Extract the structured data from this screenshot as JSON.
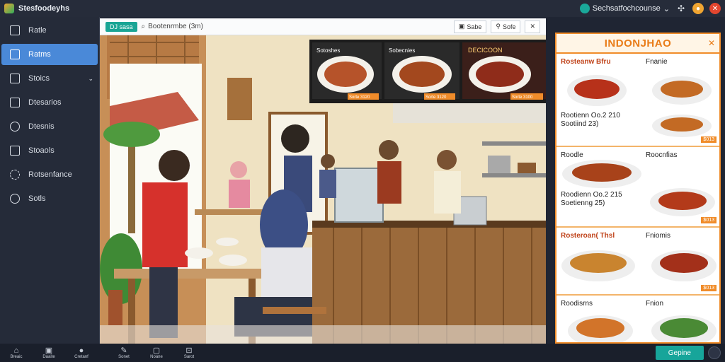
{
  "window": {
    "title": "Stesfoodeyhs"
  },
  "account": {
    "label": "Sechsatfochcounse"
  },
  "sidebar": {
    "items": [
      {
        "label": "Ratle"
      },
      {
        "label": "Ratms"
      },
      {
        "label": "Stoics"
      },
      {
        "label": "Dtesarios"
      },
      {
        "label": "Dtesnis"
      },
      {
        "label": "Stoaols"
      },
      {
        "label": "Rotsenfance"
      },
      {
        "label": "Sotls"
      }
    ]
  },
  "toolbar": {
    "tag": "DJ sasa",
    "search_text": "Bootenrmbe (3m)",
    "tool1": "Sabe",
    "tool2": "Sofe"
  },
  "screens": {
    "label1": "Sotoshes",
    "label2": "Sobecnies",
    "label3": "DECICOON",
    "price1": "Sorte 3120",
    "price2": "Sorte 3120",
    "price3": "Sorte 3100"
  },
  "menu_panel": {
    "title": "INDONJHAO",
    "rows": [
      {
        "left": "Rosteanw Bfru",
        "right": "Fnanie",
        "sub": "Rootienn Oo.2 210\nSootiind 23)",
        "tag": "$013"
      },
      {
        "left": "Roodle",
        "right": "Roocnfias",
        "sub": "Roodienn Oo.2 215\nSoetienng 25)",
        "tag": "$013"
      },
      {
        "left": "Rosteroan( Thsl",
        "right": "Fniomis",
        "sub": "",
        "tag": "$013"
      },
      {
        "left": "Roodisrns",
        "right": "Fnion",
        "sub": "",
        "tag": ""
      }
    ]
  },
  "bottombar": {
    "items": [
      "Breaic",
      "Daaite",
      "Cretanf"
    ],
    "items2": [
      "Sonet",
      "Noane",
      "Sarot"
    ],
    "primary": "Gepine"
  },
  "colors": {
    "accent": "#4a89d8",
    "teal": "#17a59a",
    "orange": "#f08c2a"
  }
}
